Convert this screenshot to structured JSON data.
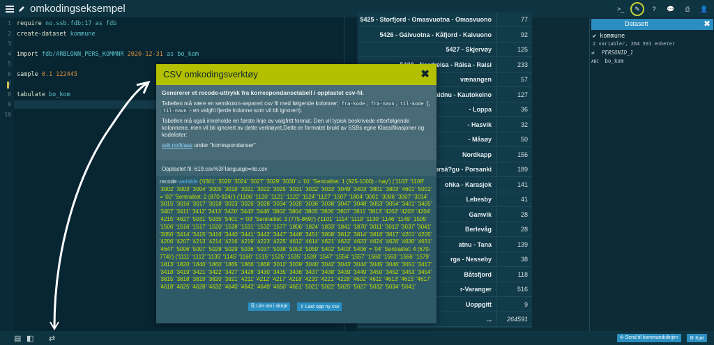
{
  "app": {
    "title": "omkodingseksempel"
  },
  "toolbar": {
    "buttons": [
      "console-icon",
      "edit-icon",
      "help-icon",
      "chat-icon",
      "print-icon",
      "user-icon"
    ]
  },
  "editor": {
    "lines": [
      {
        "n": "1",
        "tokens": [
          {
            "t": "require ",
            "c": "kw"
          },
          {
            "t": "no.ssb.fdb:17 as fdb",
            "c": "teal"
          }
        ]
      },
      {
        "n": "2",
        "tokens": [
          {
            "t": "create-dataset ",
            "c": "kw"
          },
          {
            "t": "kommune",
            "c": "teal"
          }
        ]
      },
      {
        "n": "3",
        "tokens": []
      },
      {
        "n": "4",
        "tokens": [
          {
            "t": "import ",
            "c": "kw"
          },
          {
            "t": "fdb/ARBLONN_PERS_KOMMNR ",
            "c": "teal"
          },
          {
            "t": "2020-12-31 ",
            "c": "orange"
          },
          {
            "t": "as bo_kom",
            "c": "teal"
          }
        ]
      },
      {
        "n": "5",
        "tokens": []
      },
      {
        "n": "6",
        "tokens": [
          {
            "t": "sample ",
            "c": "kw"
          },
          {
            "t": "0.1 122445",
            "c": "orange"
          }
        ]
      },
      {
        "n": "7",
        "tokens": []
      },
      {
        "n": "8",
        "tokens": [
          {
            "t": "tabulate ",
            "c": "kw"
          },
          {
            "t": "bo_kom",
            "c": "teal"
          }
        ]
      },
      {
        "n": "9",
        "tokens": []
      },
      {
        "n": "10",
        "tokens": []
      }
    ]
  },
  "table": {
    "rows": [
      {
        "name": "5425 - Storfjord - Omasvuotna - Omasvuono",
        "value": "77"
      },
      {
        "name": "5426 - Gáivuotna - Kåfjord - Kaivuono",
        "value": "92"
      },
      {
        "name": "5427 - Skjervøy",
        "value": "125"
      },
      {
        "name": "5428 - Nordreisa - Ráisa - Raisi",
        "value": "233"
      },
      {
        "name": "vænangen",
        "value": "57"
      },
      {
        "name": "aidnu - Kautokeino",
        "value": "127"
      },
      {
        "name": "- Loppa",
        "value": "36"
      },
      {
        "name": "- Hasvik",
        "value": "32"
      },
      {
        "name": "- Måsøy",
        "value": "50"
      },
      {
        "name": "Nordkapp",
        "value": "156"
      },
      {
        "name": "Porsá?gu - Porsanki",
        "value": "189"
      },
      {
        "name": "ohka - Karasjok",
        "value": "141"
      },
      {
        "name": "Lebesby",
        "value": "41"
      },
      {
        "name": "Gamvik",
        "value": "28"
      },
      {
        "name": "Berlevåg",
        "value": "28"
      },
      {
        "name": "atnu - Tana",
        "value": "139"
      },
      {
        "name": "rga - Nesseby",
        "value": "38"
      },
      {
        "name": "Båtsfjord",
        "value": "118"
      },
      {
        "name": "r-Varanger",
        "value": "516"
      },
      {
        "name": "Uoppgitt",
        "value": "9"
      },
      {
        "name": "...",
        "value": "264591"
      }
    ]
  },
  "datasets": {
    "header": "Datasett",
    "name": "kommune",
    "info": "2 variabler, 264 591 enheter",
    "vars": [
      {
        "type": "⇄",
        "name": "PERSONID_1"
      },
      {
        "type": "ABC",
        "name": "bo_kom"
      }
    ]
  },
  "modal": {
    "title": "CSV omkodingsverktøy",
    "lead": "Genererer et recode-uttrykk fra korrespondansetabell i opplastet csv-fil.",
    "p1a": "Tabellen må være en semikolon-separert csv fil med følgende kolonner:",
    "col1": "fra-kode",
    "col2": "fra-navn",
    "col3": "til-kode",
    "col4": "til-navn",
    "p1b": "- en valgfri fjerde kolonne som vil bli ignorert).",
    "p2": "Tabellen må også inneholde en første linje av valgfritt format. Den vil typisk beskrivede etterfølgende kolonnene, men vil bli ignorert av dette verktøyet.Dette er formatet brukt av SSBs egne Klassifikasjoner og kodelister:",
    "link": "ssb.no/klass",
    "link_suffix": " under \"korrespondanser\"",
    "file": "Opplastet fil: 619.csv%3Flanguage=nb.csv",
    "recode_kw": "recode ",
    "recode_var": "variable ",
    "recode_text": "('0301' '3020' '3024' '3027' '3029' '3030' = '01' 'Sentralitet: 1 (925-1000) - høy') ('1103' '1108' '3002' '3003' '3004' '3005' '3019' '3021' '3022' '3025' '3031' '3032' '3033' '3049' '3403' '3801' '3803' '4601' '5001' = '02' 'Sentralitet: 2 (870-924)') ('1106' '1120' '1121' '1122' '1124' '1127' '1507' '1804' '3001' '3006' '3007' '3014' '3015' '3016' '3017' '3018' '3023' '3026' '3028' '3034' '3035' '3036' '3038' '3047' '3048' '3053' '3054' '3401' '3405' '3407' '3411' '3412' '3413' '3420' '3443' '3446' '3802' '3804' '3805' '3806' '3807' '3811' '3813' '4202' '4203' '4204' '4215' '4627' '5031' '5035' '5401' = '03' 'Sentralitet: 3 (775-869)') ('1101' '1114' '1119' '1130' '1146' '1149' '1505' '1506' '1516' '1517' '1520' '1528' '1531' '1532' '1577' '1806' '1824' '1833' '1841' '1870' '3011' '3013' '3037' '3041' '3050' '3414' '3415' '3416' '3440' '3441' '3442' '3447' '3448' '3451' '3808' '3812' '3814' '3816' '3817' '4201' '4205' '4206' '4207' '4213' '4214' '4216' '4219' '4223' '4225' '4612' '4614' '4621' '4622' '4623' '4624' '4626' '4630' '4631' '4647' '5006' '5007' '5028' '5029' '5036' '5037' '5038' '5053' '5059' '5402' '5403' '5406' = '04' 'Sentralitet: 4 (670-774)') ('1111' '1112' '1135' '1145' '1160' '1515' '1525' '1535' '1539' '1547' '1554' '1557' '1560' '1563' '1566' '1579' '1813' '1820' '1840' '1860' '1865' '1866' '1868' '3012' '3039' '3040' '3042' '3043' '3044' '3045' '3046' '3051' '3417' '3418' '3419' '3421' '3422' '3427' '3428' '3430' '3435' '3436' '3437' '3438' '3439' '3449' '3450' '3452' '3453' '3454' '3815' '3818' '3819' '3820' '3821' '4211' '4212' '4217' '4218' '4220' '4221' '4228' '4602' '4611' '4613' '4615' '4617' '4618' '4625' '4628' '4632' '4640' '4642' '4649' '4650' '4651' '5021' '5022' '5025' '5027' '5032' '5034' '5041'",
    "btn_insert": "Lim inn i skript",
    "btn_upload": "Last opp ny csv"
  },
  "bottombar": {
    "send_btn": "Send til kommandolinjen",
    "run_btn": "Kjør"
  }
}
